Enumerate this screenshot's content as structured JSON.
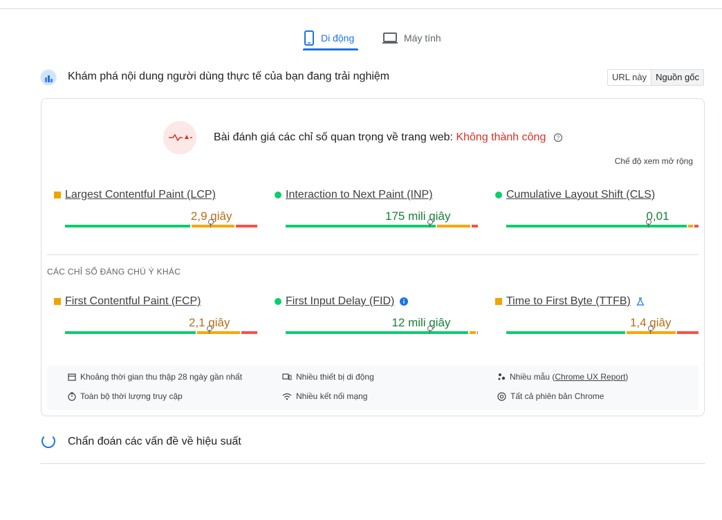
{
  "tabs": {
    "mobile": "Di động",
    "desktop": "Máy tính"
  },
  "header": {
    "title": "Khám phá nội dung người dùng thực tế của bạn đang trải nghiệm",
    "toggle_url": "URL này",
    "toggle_origin": "Nguồn gốc"
  },
  "assessment": {
    "label": "Bài đánh giá các chỉ số quan trọng về trang web:",
    "status": "Không thành công",
    "expand": "Chế độ xem mở rộng"
  },
  "core_metrics": [
    {
      "name": "Largest Contentful Paint (LCP)",
      "value": "2,9 giây",
      "rating": "needs-improvement",
      "distribution": [
        0.65,
        0.23,
        0.12
      ],
      "marker": 0.76
    },
    {
      "name": "Interaction to Next Paint (INP)",
      "value": "175 mili giây",
      "rating": "good",
      "distribution": [
        0.78,
        0.18,
        0.04
      ],
      "marker": 0.75
    },
    {
      "name": "Cumulative Layout Shift (CLS)",
      "value": "0,01",
      "rating": "good",
      "distribution": [
        0.94,
        0.03,
        0.03
      ],
      "marker": 0.74
    }
  ],
  "other_title": "CÁC CHỈ SỐ ĐÁNG CHÚ Ý KHÁC",
  "other_metrics": [
    {
      "name": "First Contentful Paint (FCP)",
      "value": "2,1 giây",
      "rating": "needs-improvement",
      "distribution": [
        0.68,
        0.23,
        0.09
      ],
      "marker": 0.75
    },
    {
      "name": "First Input Delay (FID)",
      "value": "12 mili giây",
      "rating": "good",
      "distribution": [
        0.95,
        0.04,
        0.01
      ],
      "marker": 0.75
    },
    {
      "name": "Time to First Byte (TTFB)",
      "value": "1,4 giây",
      "rating": "needs-improvement",
      "distribution": [
        0.62,
        0.26,
        0.12
      ],
      "marker": 0.75
    }
  ],
  "info": {
    "period": "Khoảng thời gian thu thập 28 ngày gần nhất",
    "devices": "Nhiều thiết bị di động",
    "samples_prefix": "Nhiều mẫu (",
    "samples_link": "Chrome UX Report",
    "samples_suffix": ")",
    "duration": "Toàn bộ thời lượng truy cập",
    "network": "Nhiều kết nối mạng",
    "chrome": "Tất cả phiên bản Chrome"
  },
  "diagnostics_title": "Chẩn đoán các vấn đề về hiệu suất",
  "colors": {
    "accent": "#1a73e8",
    "good": "#0cce6b",
    "average": "#ffa400",
    "poor": "#ff4e42",
    "fail": "#d93025"
  }
}
